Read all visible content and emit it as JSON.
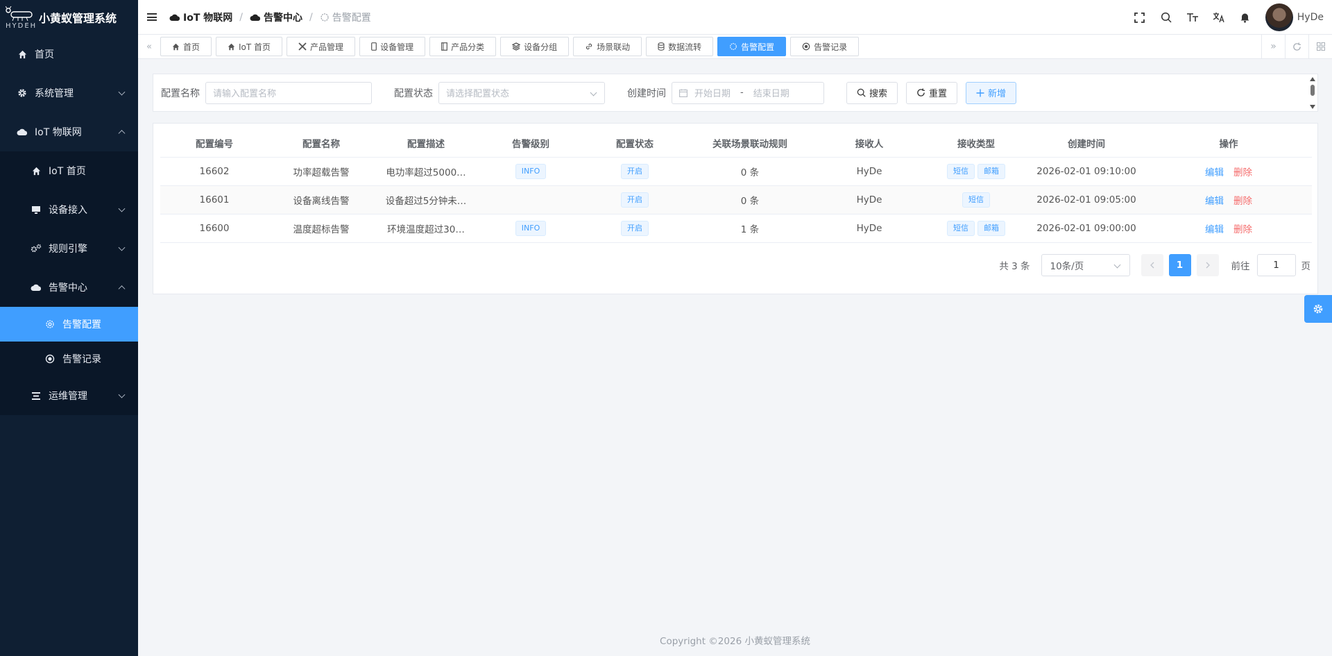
{
  "app": {
    "title": "小黄蚁管理系统",
    "brand": "HYDEH"
  },
  "sidebar": {
    "items": [
      {
        "label": "首页",
        "icon": "home-icon"
      },
      {
        "label": "系统管理",
        "icon": "gear-icon"
      },
      {
        "label": "IoT 物联网",
        "icon": "cloud-icon"
      },
      {
        "label": "IoT 首页",
        "icon": "home-icon"
      },
      {
        "label": "设备接入",
        "icon": "monitor-icon"
      },
      {
        "label": "规则引擎",
        "icon": "cogs-icon"
      },
      {
        "label": "告警中心",
        "icon": "cloud-icon"
      },
      {
        "label": "告警配置",
        "icon": "chip-icon"
      },
      {
        "label": "告警记录",
        "icon": "record-icon"
      },
      {
        "label": "运维管理",
        "icon": "stack-icon"
      }
    ]
  },
  "breadcrumb": [
    "IoT 物联网",
    "告警中心",
    "告警配置"
  ],
  "user": {
    "name": "HyDe"
  },
  "tags": [
    "首页",
    "IoT 首页",
    "产品管理",
    "设备管理",
    "产品分类",
    "设备分组",
    "场景联动",
    "数据流转",
    "告警配置",
    "告警记录"
  ],
  "search": {
    "name_label": "配置名称",
    "name_placeholder": "请输入配置名称",
    "status_label": "配置状态",
    "status_placeholder": "请选择配置状态",
    "time_label": "创建时间",
    "start_placeholder": "开始日期",
    "range_sep": "-",
    "end_placeholder": "结束日期",
    "search_btn": "搜索",
    "reset_btn": "重置",
    "add_btn": "新增"
  },
  "table": {
    "headers": [
      "配置编号",
      "配置名称",
      "配置描述",
      "告警级别",
      "配置状态",
      "关联场景联动规则",
      "接收人",
      "接收类型",
      "创建时间",
      "操作"
    ],
    "rows": [
      {
        "id": "16602",
        "name": "功率超载告警",
        "desc": "电功率超过5000…",
        "level": "INFO",
        "status": "开启",
        "rules": "0 条",
        "receiver": "HyDe",
        "types": [
          "短信",
          "邮箱"
        ],
        "created": "2026-02-01 09:10:00"
      },
      {
        "id": "16601",
        "name": "设备离线告警",
        "desc": "设备超过5分钟未…",
        "level": "",
        "status": "开启",
        "rules": "0 条",
        "receiver": "HyDe",
        "types": [
          "短信"
        ],
        "created": "2026-02-01 09:05:00"
      },
      {
        "id": "16600",
        "name": "温度超标告警",
        "desc": "环境温度超过30…",
        "level": "INFO",
        "status": "开启",
        "rules": "1 条",
        "receiver": "HyDe",
        "types": [
          "短信",
          "邮箱"
        ],
        "created": "2026-02-01 09:00:00"
      }
    ],
    "edit": "编辑",
    "delete": "删除"
  },
  "pagination": {
    "total": "共 3 条",
    "page_size": "10条/页",
    "current": "1",
    "goto_label": "前往",
    "goto_value": "1",
    "page_suffix": "页"
  },
  "footer": "Copyright ©2026 小黄蚁管理系统",
  "colors": {
    "primary": "#409eff",
    "danger": "#f56c6c",
    "sidebar": "#0f1f33"
  }
}
